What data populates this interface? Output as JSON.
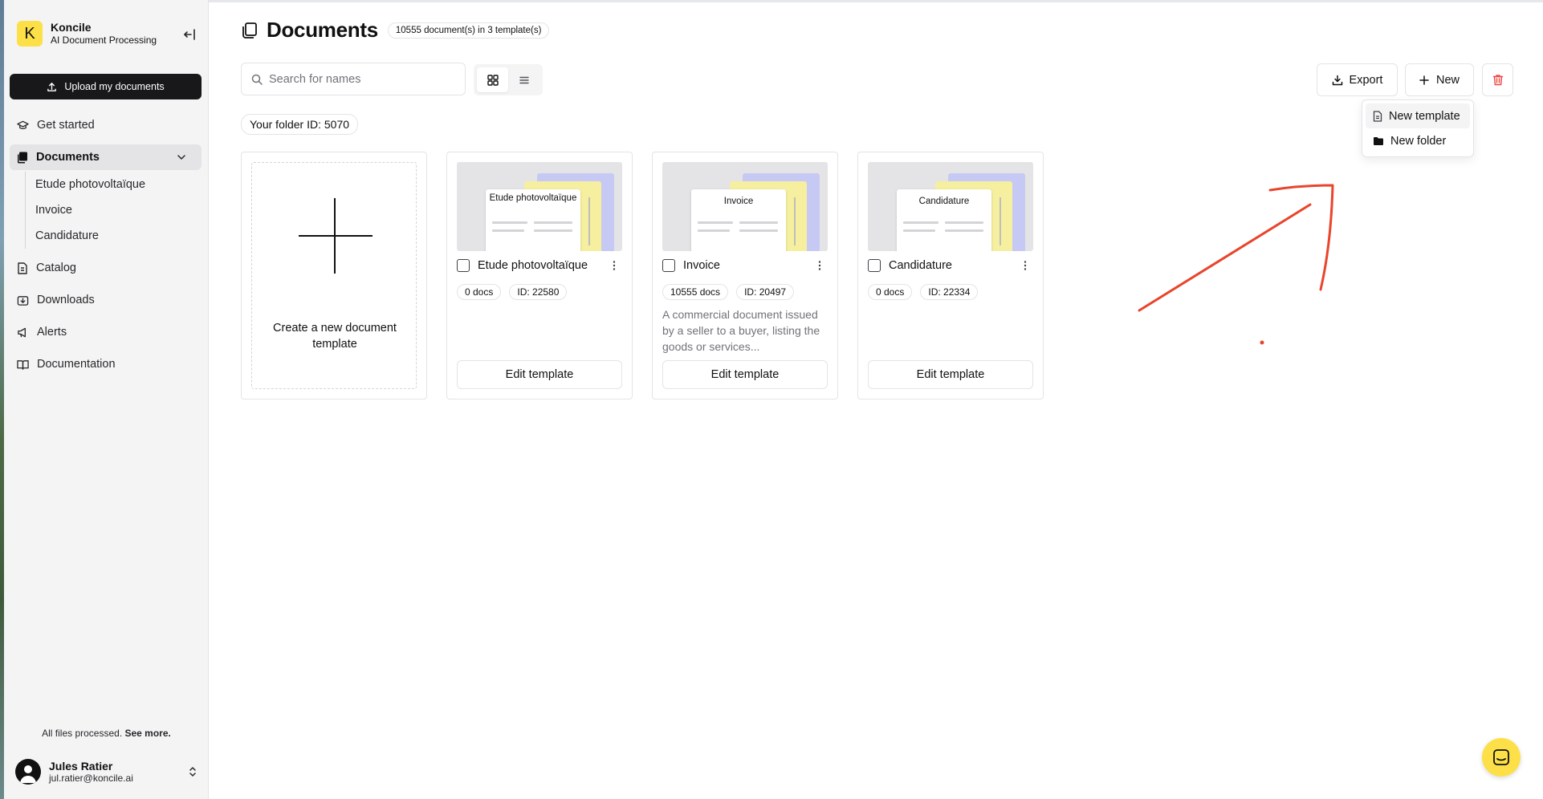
{
  "brand": {
    "logo_letter": "K",
    "name": "Koncile",
    "subtitle": "AI Document Processing",
    "accent": "#fde047"
  },
  "sidebar": {
    "upload_label": "Upload my documents",
    "items": [
      {
        "label": "Get started",
        "icon": "graduation-cap-icon"
      },
      {
        "label": "Documents",
        "icon": "documents-icon",
        "active": true
      },
      {
        "label": "Catalog",
        "icon": "catalog-icon"
      },
      {
        "label": "Downloads",
        "icon": "downloads-icon"
      },
      {
        "label": "Alerts",
        "icon": "megaphone-icon"
      },
      {
        "label": "Documentation",
        "icon": "book-icon"
      }
    ],
    "documents_children": [
      "Etude photovoltaïque",
      "Invoice",
      "Candidature"
    ],
    "status_text": "All files processed.",
    "status_link": "See more."
  },
  "user": {
    "name": "Jules Ratier",
    "email": "jul.ratier@koncile.ai"
  },
  "header": {
    "title": "Documents",
    "count_badge": "10555 document(s) in 3 template(s)"
  },
  "search": {
    "placeholder": "Search for names",
    "value": ""
  },
  "folder_badge": "Your folder ID: 5070",
  "toolbar": {
    "export_label": "Export",
    "new_label": "New"
  },
  "new_menu": {
    "items": [
      "New template",
      "New folder"
    ]
  },
  "create_card": {
    "label": "Create a new document template"
  },
  "templates": [
    {
      "name": "Etude photovoltaïque",
      "thumb_title": "Etude photovoltaïque",
      "docs": "0 docs",
      "id": "ID: 22580",
      "description": "",
      "edit_label": "Edit template"
    },
    {
      "name": "Invoice",
      "thumb_title": "Invoice",
      "docs": "10555 docs",
      "id": "ID: 20497",
      "description": "A commercial document issued by a seller to a buyer, listing the goods or services...",
      "edit_label": "Edit template"
    },
    {
      "name": "Candidature",
      "thumb_title": "Candidature",
      "docs": "0 docs",
      "id": "ID: 22334",
      "description": "",
      "edit_label": "Edit template"
    }
  ],
  "colors": {
    "sidebar_bg": "#f4f4f5",
    "primary_button": "#18181b",
    "danger": "#ef4444",
    "annotation": "#e8452c"
  }
}
